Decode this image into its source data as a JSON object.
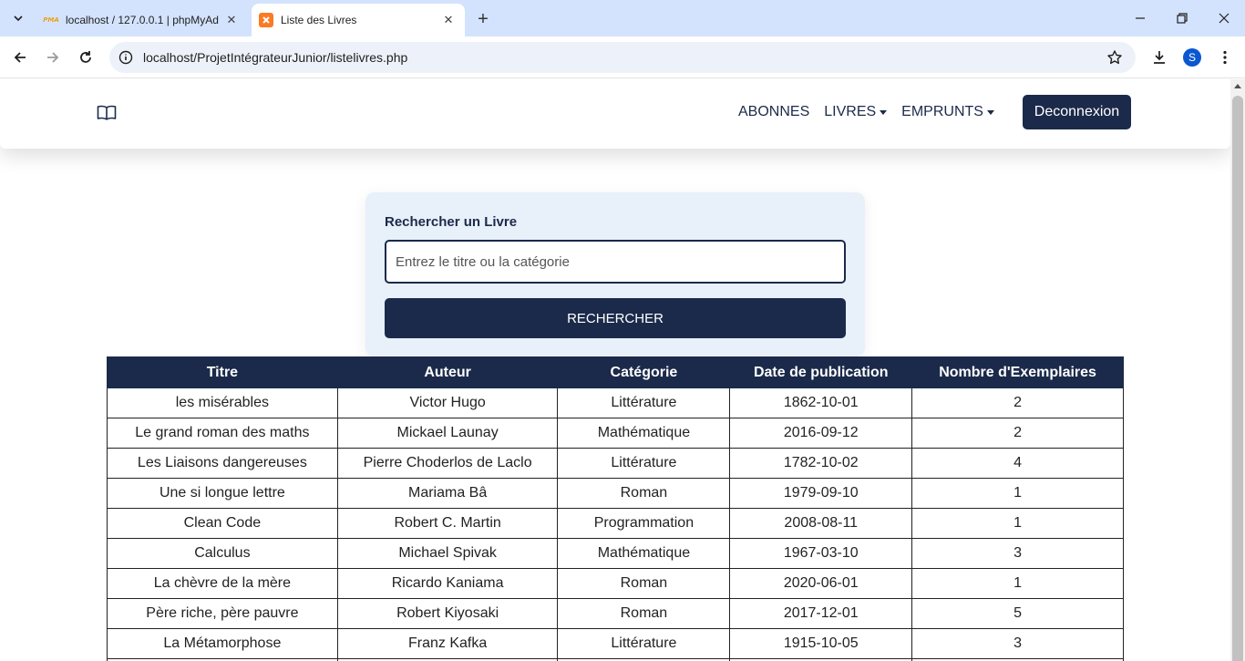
{
  "browser": {
    "tabs": [
      {
        "title": "localhost / 127.0.0.1 | phpMyAd",
        "favicon": "PMA",
        "active": false
      },
      {
        "title": "Liste des Livres",
        "favicon": "xampp-icon",
        "active": true
      }
    ],
    "url": "localhost/ProjetIntégrateurJunior/listelivres.php",
    "profile_initial": "S"
  },
  "navbar": {
    "brand_icon": "book-icon",
    "links": [
      {
        "label": "ABONNES",
        "dropdown": false
      },
      {
        "label": "LIVRES",
        "dropdown": true
      },
      {
        "label": "EMPRUNTS",
        "dropdown": true
      }
    ],
    "logout_label": "Deconnexion"
  },
  "search": {
    "label": "Rechercher un Livre",
    "placeholder": "Entrez le titre ou la catégorie",
    "value": "",
    "button_label": "RECHERCHER"
  },
  "table": {
    "headers": [
      "Titre",
      "Auteur",
      "Catégorie",
      "Date de publication",
      "Nombre d'Exemplaires"
    ],
    "rows": [
      [
        "les misérables",
        "Victor Hugo",
        "Littérature",
        "1862-10-01",
        "2"
      ],
      [
        "Le grand roman des maths",
        "Mickael Launay",
        "Mathématique",
        "2016-09-12",
        "2"
      ],
      [
        "Les Liaisons dangereuses",
        "Pierre Choderlos de Laclo",
        "Littérature",
        "1782-10-02",
        "4"
      ],
      [
        "Une si longue lettre",
        "Mariama Bâ",
        "Roman",
        "1979-09-10",
        "1"
      ],
      [
        "Clean Code",
        "Robert C. Martin",
        "Programmation",
        "2008-08-11",
        "1"
      ],
      [
        "Calculus",
        "Michael Spivak",
        "Mathématique",
        "1967-03-10",
        "3"
      ],
      [
        "La chèvre de la mère",
        "Ricardo Kaniama",
        "Roman",
        "2020-06-01",
        "1"
      ],
      [
        "Père riche, père pauvre",
        "Robert Kiyosaki",
        "Roman",
        "2017-12-01",
        "5"
      ],
      [
        "La Métamorphose",
        "Franz Kafka",
        "Littérature",
        "1915-10-05",
        "3"
      ],
      [
        "",
        "",
        "",
        "",
        ""
      ]
    ]
  },
  "colors": {
    "primary": "#1b2a4a",
    "card_bg": "#e8f0fa",
    "tabbar_bg": "#d3e3fd"
  }
}
